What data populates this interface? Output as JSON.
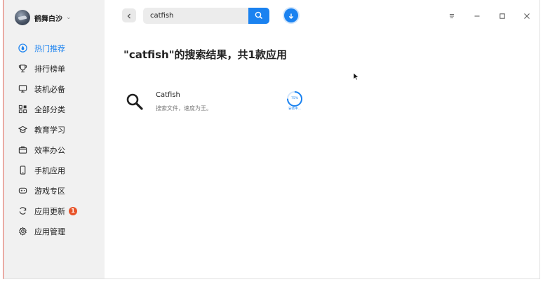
{
  "user": {
    "name": "鹤舞白沙",
    "caret": "⌄"
  },
  "nav": [
    {
      "label": "热门推荐",
      "icon": "drop-icon",
      "active": true
    },
    {
      "label": "排行榜单",
      "icon": "trophy-icon"
    },
    {
      "label": "装机必备",
      "icon": "monitor-icon"
    },
    {
      "label": "全部分类",
      "icon": "grid-icon"
    },
    {
      "label": "教育学习",
      "icon": "graduation-cap-icon"
    },
    {
      "label": "效率办公",
      "icon": "briefcase-icon"
    },
    {
      "label": "手机应用",
      "icon": "phone-icon"
    },
    {
      "label": "游戏专区",
      "icon": "gamepad-icon"
    },
    {
      "label": "应用更新",
      "icon": "refresh-icon",
      "badge": "1"
    },
    {
      "label": "应用管理",
      "icon": "gear-icon"
    }
  ],
  "search": {
    "value": "catfish"
  },
  "result": {
    "title": "\"catfish\"的搜索结果，共1款应用",
    "app": {
      "name": "Catfish",
      "description": "搜索文件，速度为王。",
      "icon": "magnifier-icon",
      "progress_percent": 75,
      "progress_text": "75%",
      "status": "安装中..."
    }
  },
  "colors": {
    "accent": "#1a82f0",
    "badge": "#e8542a",
    "sidebar_bg": "#f1f1f1"
  }
}
